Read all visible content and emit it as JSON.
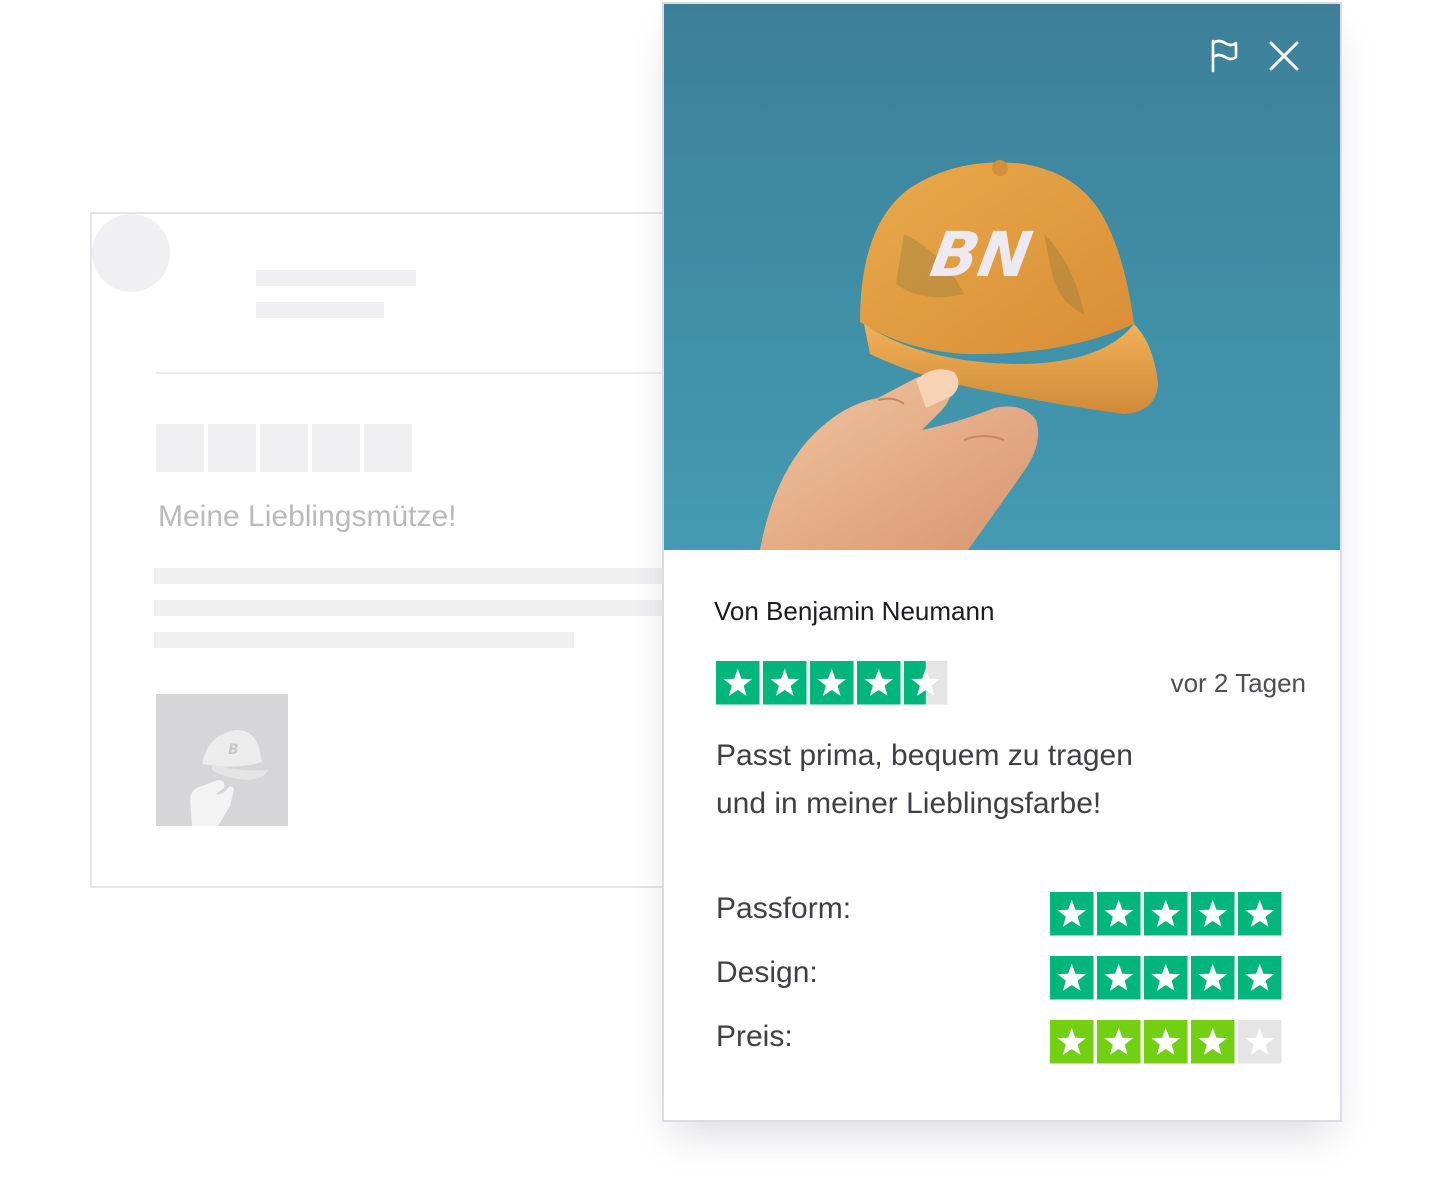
{
  "background_card": {
    "title": "Meine Lieblingsmütze!"
  },
  "review": {
    "author": "Von Benjamin Neumann",
    "rating": 4.5,
    "date": "vor 2 Tagen",
    "text_lines": [
      "Passt prima, bequem zu tragen",
      "und in meiner Lieblingsfarbe!"
    ],
    "photo_monogram": "BN",
    "criteria": [
      {
        "label": "Passform:",
        "rating": 5
      },
      {
        "label": "Design:",
        "rating": 5
      },
      {
        "label": "Preis:",
        "rating": 4
      }
    ],
    "actions": {
      "flag_icon": "flag-icon",
      "close_icon": "close-icon"
    }
  },
  "colors": {
    "star_green": "#00b67a",
    "star_light_green": "#73cf11",
    "star_empty": "#e5e5e5",
    "skeleton": "#f0f0f2"
  }
}
